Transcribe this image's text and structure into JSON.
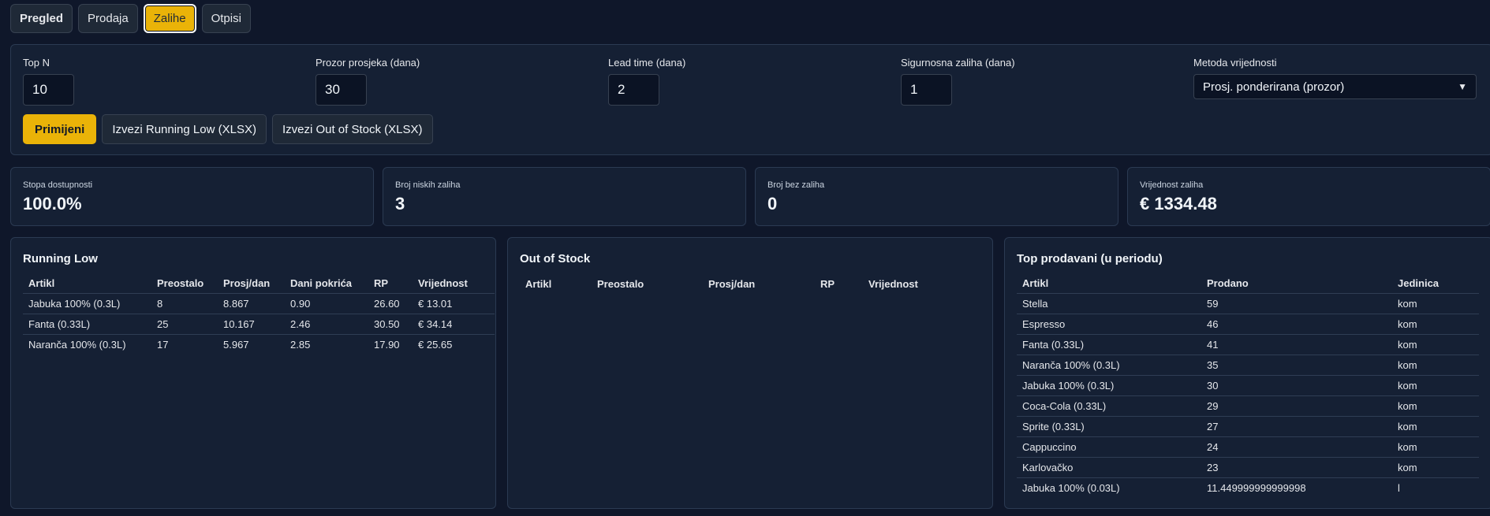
{
  "tabs": [
    "Pregled",
    "Prodaja",
    "Zalihe",
    "Otpisi"
  ],
  "filters": {
    "top_n": {
      "label": "Top N",
      "value": "10"
    },
    "window": {
      "label": "Prozor prosjeka (dana)",
      "value": "30"
    },
    "lead": {
      "label": "Lead time (dana)",
      "value": "2"
    },
    "safety": {
      "label": "Sigurnosna zaliha (dana)",
      "value": "1"
    },
    "method": {
      "label": "Metoda vrijednosti",
      "value": "Prosj. ponderirana (prozor)"
    }
  },
  "actions": {
    "apply": "Primijeni",
    "export_low": "Izvezi Running Low (XLSX)",
    "export_oos": "Izvezi Out of Stock (XLSX)"
  },
  "kpis": [
    {
      "label": "Stopa dostupnosti",
      "value": "100.0%"
    },
    {
      "label": "Broj niskih zaliha",
      "value": "3"
    },
    {
      "label": "Broj bez zaliha",
      "value": "0"
    },
    {
      "label": "Vrijednost zaliha",
      "value": "€ 1334.48"
    }
  ],
  "running_low": {
    "title": "Running Low",
    "headers": [
      "Artikl",
      "Preostalo",
      "Prosj/dan",
      "Dani pokrića",
      "RP",
      "Vrijednost"
    ],
    "rows": [
      [
        "Jabuka 100% (0.3L)",
        "8",
        "8.867",
        "0.90",
        "26.60",
        "€ 13.01"
      ],
      [
        "Fanta (0.33L)",
        "25",
        "10.167",
        "2.46",
        "30.50",
        "€ 34.14"
      ],
      [
        "Naranča 100% (0.3L)",
        "17",
        "5.967",
        "2.85",
        "17.90",
        "€ 25.65"
      ]
    ]
  },
  "out_of_stock": {
    "title": "Out of Stock",
    "headers": [
      "Artikl",
      "Preostalo",
      "Prosj/dan",
      "RP",
      "Vrijednost"
    ],
    "rows": []
  },
  "top_sold": {
    "title": "Top prodavani (u periodu)",
    "headers": [
      "Artikl",
      "Prodano",
      "Jedinica"
    ],
    "rows": [
      [
        "Stella",
        "59",
        "kom"
      ],
      [
        "Espresso",
        "46",
        "kom"
      ],
      [
        "Fanta (0.33L)",
        "41",
        "kom"
      ],
      [
        "Naranča 100% (0.3L)",
        "35",
        "kom"
      ],
      [
        "Jabuka 100% (0.3L)",
        "30",
        "kom"
      ],
      [
        "Coca-Cola (0.33L)",
        "29",
        "kom"
      ],
      [
        "Sprite (0.33L)",
        "27",
        "kom"
      ],
      [
        "Cappuccino",
        "24",
        "kom"
      ],
      [
        "Karlovačko",
        "23",
        "kom"
      ],
      [
        "Jabuka 100% (0.03L)",
        "11.449999999999998",
        "l"
      ]
    ]
  }
}
